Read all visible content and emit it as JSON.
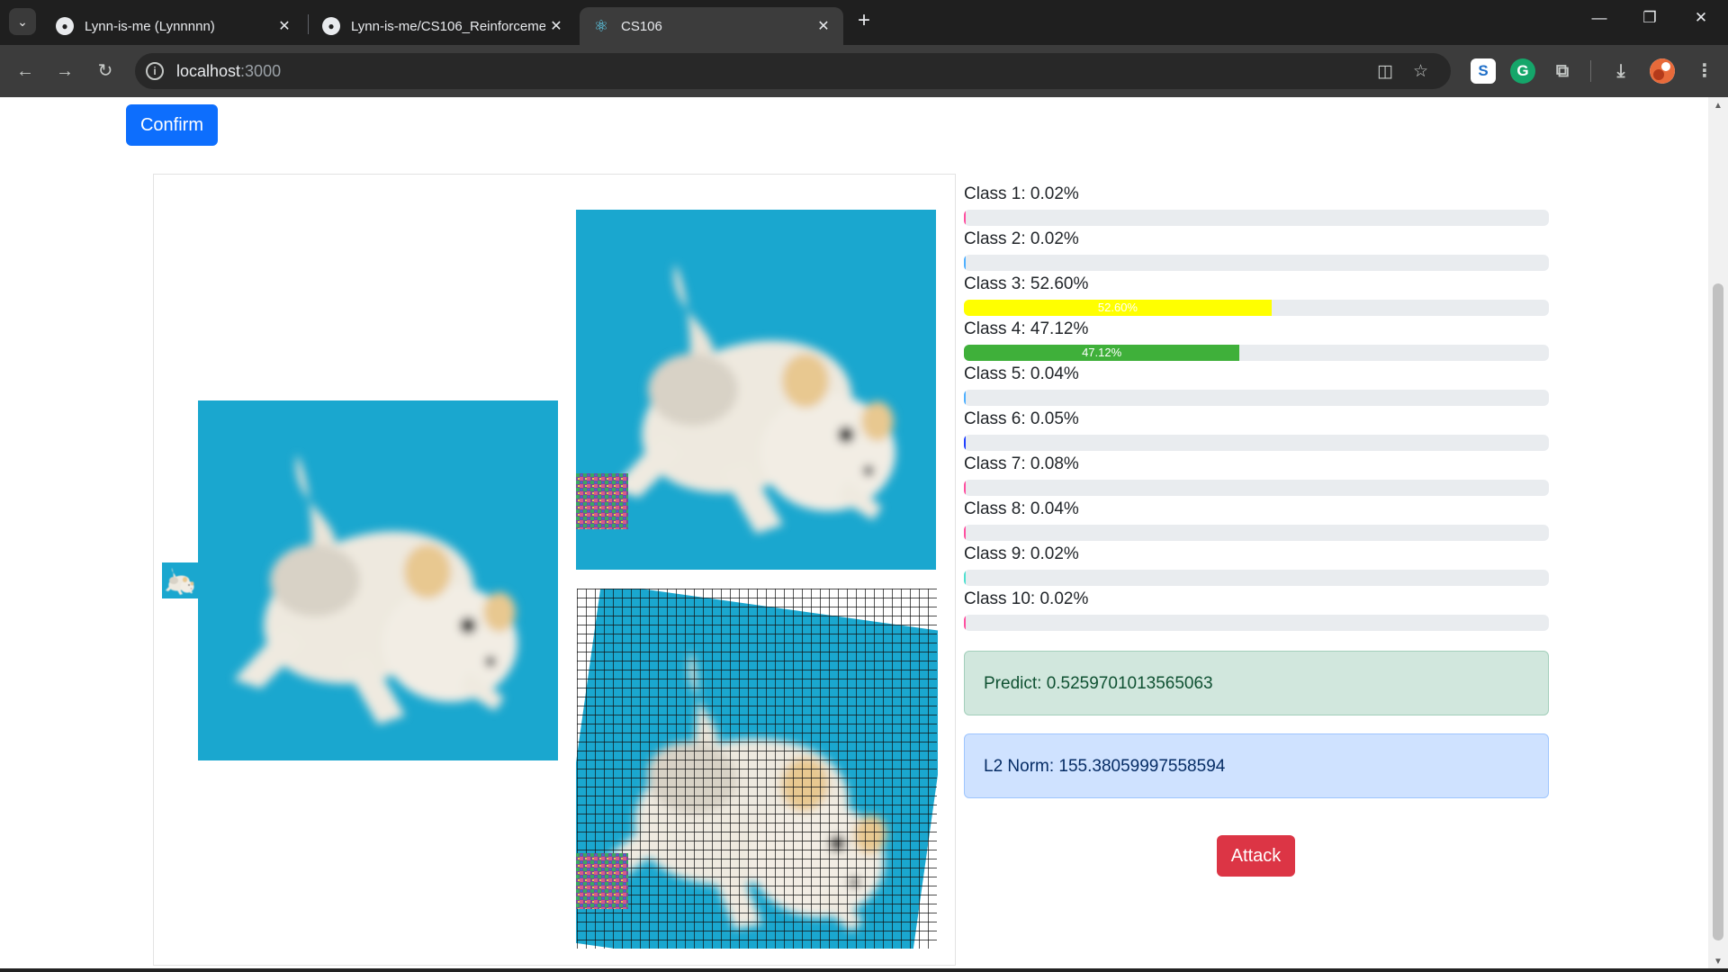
{
  "browser": {
    "tabs": [
      {
        "title": "Lynn-is-me (Lynnnnn)",
        "icon": "github-icon"
      },
      {
        "title": "Lynn-is-me/CS106_Reinforceme",
        "icon": "github-icon"
      },
      {
        "title": "CS106",
        "icon": "react-icon"
      }
    ],
    "url_host": "localhost",
    "url_port": ":3000"
  },
  "page": {
    "confirm_label": "Confirm",
    "attack_label": "Attack",
    "classes": [
      {
        "label": "Class 1: 0.02%",
        "value": 0.02,
        "color": "#ff4fa0",
        "bar_text": ""
      },
      {
        "label": "Class 2: 0.02%",
        "value": 0.02,
        "color": "#4fb0ff",
        "bar_text": ""
      },
      {
        "label": "Class 3: 52.60%",
        "value": 52.6,
        "color": "#ffff00",
        "bar_text": "52.60%"
      },
      {
        "label": "Class 4: 47.12%",
        "value": 47.12,
        "color": "#3fb03a",
        "bar_text": "47.12%"
      },
      {
        "label": "Class 5: 0.04%",
        "value": 0.04,
        "color": "#4fb0ff",
        "bar_text": ""
      },
      {
        "label": "Class 6: 0.05%",
        "value": 0.05,
        "color": "#2040ff",
        "bar_text": ""
      },
      {
        "label": "Class 7: 0.08%",
        "value": 0.08,
        "color": "#ff4fa0",
        "bar_text": ""
      },
      {
        "label": "Class 8: 0.04%",
        "value": 0.04,
        "color": "#ff4fa0",
        "bar_text": ""
      },
      {
        "label": "Class 9: 0.02%",
        "value": 0.02,
        "color": "#4fe0d0",
        "bar_text": ""
      },
      {
        "label": "Class 10: 0.02%",
        "value": 0.02,
        "color": "#ff4fa0",
        "bar_text": ""
      }
    ],
    "predict_text": "Predict: 0.5259701013565063",
    "l2_text": "L2 Norm: 155.38059997558594"
  }
}
